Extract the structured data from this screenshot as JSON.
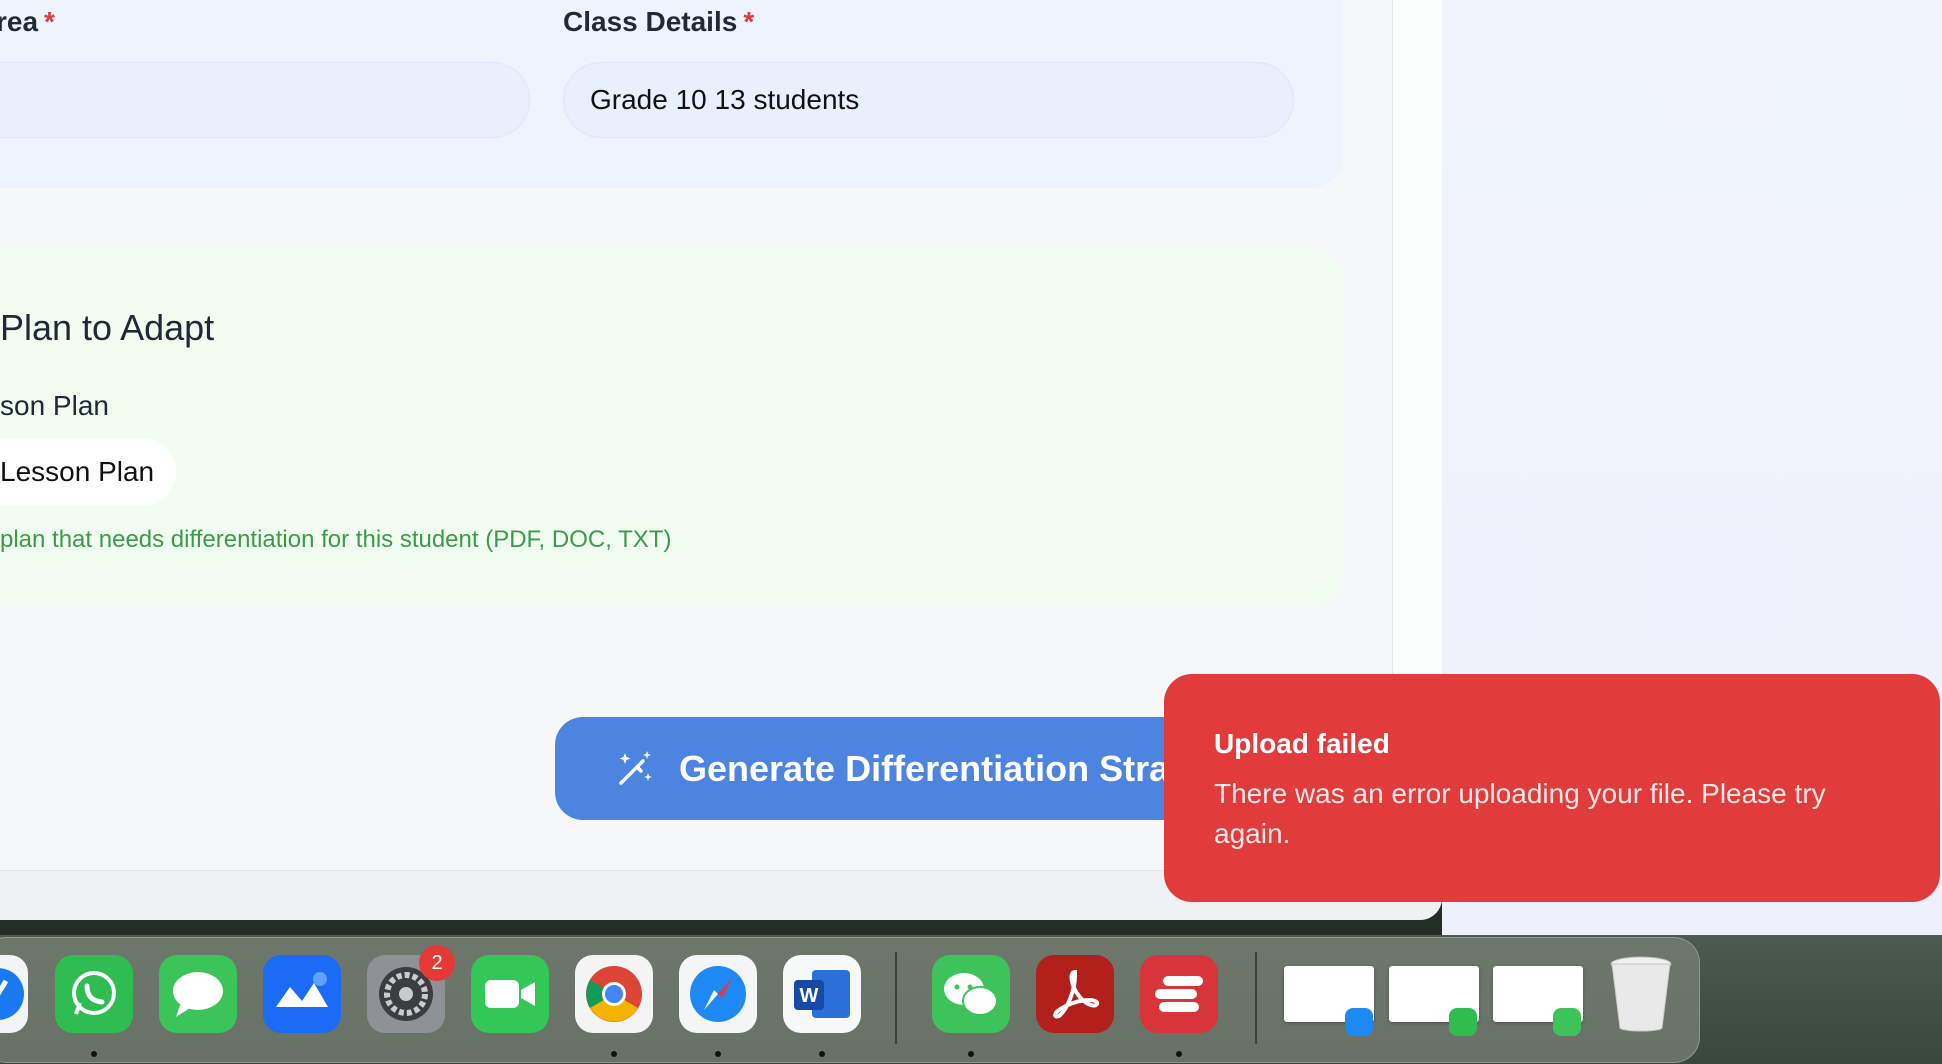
{
  "form": {
    "subject_area_label_fragment": "rea",
    "class_details_label": "Class Details",
    "required_mark": "*",
    "class_details_value": "Grade 10 13 students",
    "lesson_section_title": "Plan to Adapt",
    "lesson_plan_label": "son Plan",
    "upload_button_label": "Lesson Plan",
    "upload_hint": "plan that needs differentiation for this student (PDF, DOC, TXT)",
    "generate_button_label": "Generate Differentiation Strategies"
  },
  "toast": {
    "title": "Upload failed",
    "message": "There was an error uploading your file. Please try again."
  },
  "dock": {
    "system_settings_badge": "2",
    "apps": [
      "safari-partial",
      "whatsapp",
      "messages",
      "lark",
      "system-settings",
      "facetime",
      "chrome",
      "safari",
      "word",
      "wechat",
      "acrobat",
      "expressvpn"
    ],
    "colors": {
      "whatsapp": "#2fbd52",
      "messages": "#3bc45a",
      "facetime": "#33c758",
      "wechat": "#3ec35b",
      "acrobat": "#b3201c",
      "expressvpn": "#d8353a"
    }
  }
}
